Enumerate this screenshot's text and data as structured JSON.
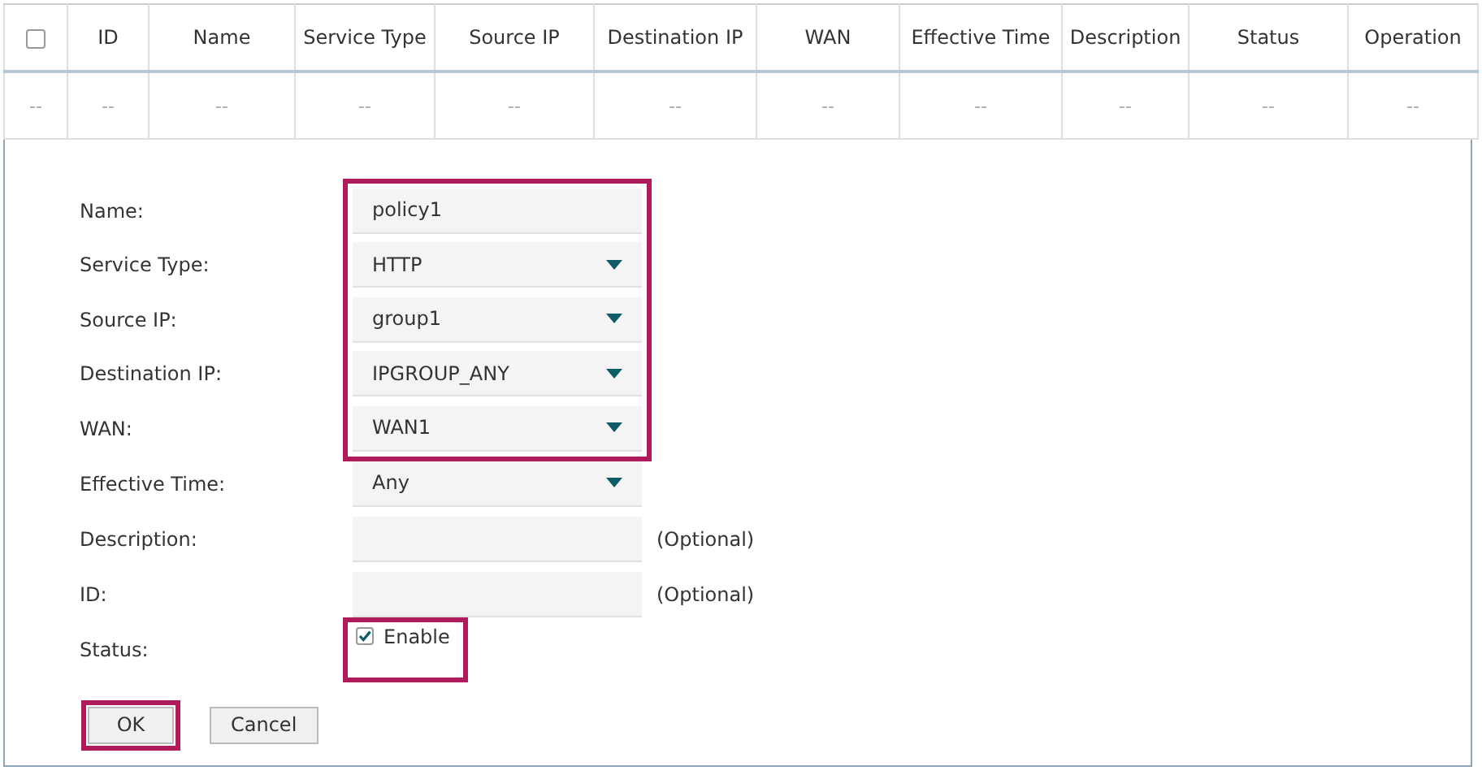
{
  "table": {
    "columns": [
      {
        "kind": "checkbox",
        "checked": false
      },
      "ID",
      "Name",
      "Service Type",
      "Source IP",
      "Destination IP",
      "WAN",
      "Effective Time",
      "Description",
      "Status",
      "Operation"
    ],
    "rows": [
      {
        "cells": [
          "--",
          "--",
          "--",
          "--",
          "--",
          "--",
          "--",
          "--",
          "--",
          "--",
          "--"
        ]
      }
    ]
  },
  "form": {
    "fields": [
      {
        "kind": "text",
        "label": "Name:",
        "value": "policy1",
        "highlighted": true
      },
      {
        "kind": "select",
        "label": "Service Type:",
        "value": "HTTP",
        "highlighted": true
      },
      {
        "kind": "select",
        "label": "Source IP:",
        "value": "group1",
        "highlighted": true
      },
      {
        "kind": "select",
        "label": "Destination IP:",
        "value": "IPGROUP_ANY",
        "highlighted": true
      },
      {
        "kind": "select",
        "label": "WAN:",
        "value": "WAN1",
        "highlighted": true
      },
      {
        "kind": "select",
        "label": "Effective Time:",
        "value": "Any",
        "highlighted": false
      },
      {
        "kind": "text",
        "label": "Description:",
        "note": "(Optional)",
        "highlighted": false
      },
      {
        "kind": "text",
        "label": "ID:",
        "note": "(Optional)",
        "highlighted": false
      },
      {
        "kind": "checkbox",
        "label": "Status:",
        "option": "Enable",
        "checked": true,
        "highlighted": true
      }
    ],
    "buttons": [
      {
        "label": "OK",
        "highlighted": true
      },
      {
        "label": "Cancel",
        "highlighted": false
      }
    ]
  }
}
